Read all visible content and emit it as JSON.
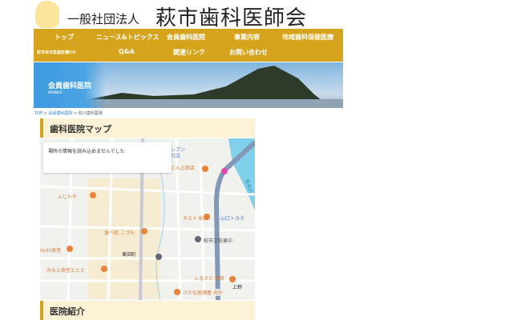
{
  "header": {
    "org_prefix": "一般社団法人",
    "org_name": "萩市歯科医師会"
  },
  "nav": {
    "row1": [
      "トップ",
      "ニュース&トピックス",
      "会員歯科医院",
      "事業内容",
      "地域歯科保健医療"
    ],
    "row2": [
      "萩市休日急患診療ｾﾝﾀｰ",
      "Q&A",
      "関連リンク",
      "お問い合わせ"
    ]
  },
  "banner": {
    "title": "会員歯科医院",
    "subtitle": "MEMBER"
  },
  "breadcrumb": {
    "items": [
      "TOP",
      "会員歯科医院",
      "石川歯科医院"
    ],
    "sep": " > "
  },
  "sections": {
    "map_heading": "歯科医院マップ",
    "intro_heading": "医院紹介"
  },
  "map": {
    "error": "場所の情報を読み込めませんでした",
    "labels": [
      "イレブン",
      "萩町店",
      "どん三郎店",
      "ふじたや",
      "カスト 萩店",
      "山口トヨタ",
      "食べ処 こづち",
      "萩市立萩東中",
      "michi食堂",
      "東田町",
      "みなと食堂ととと",
      "ふるさと 家族",
      "上野",
      "さかな居酒屋 みや",
      "松本川"
    ]
  },
  "colors": {
    "accent": "#d6a41c",
    "heading_bg": "#fdf1d6",
    "river": "#7fd0ea"
  }
}
